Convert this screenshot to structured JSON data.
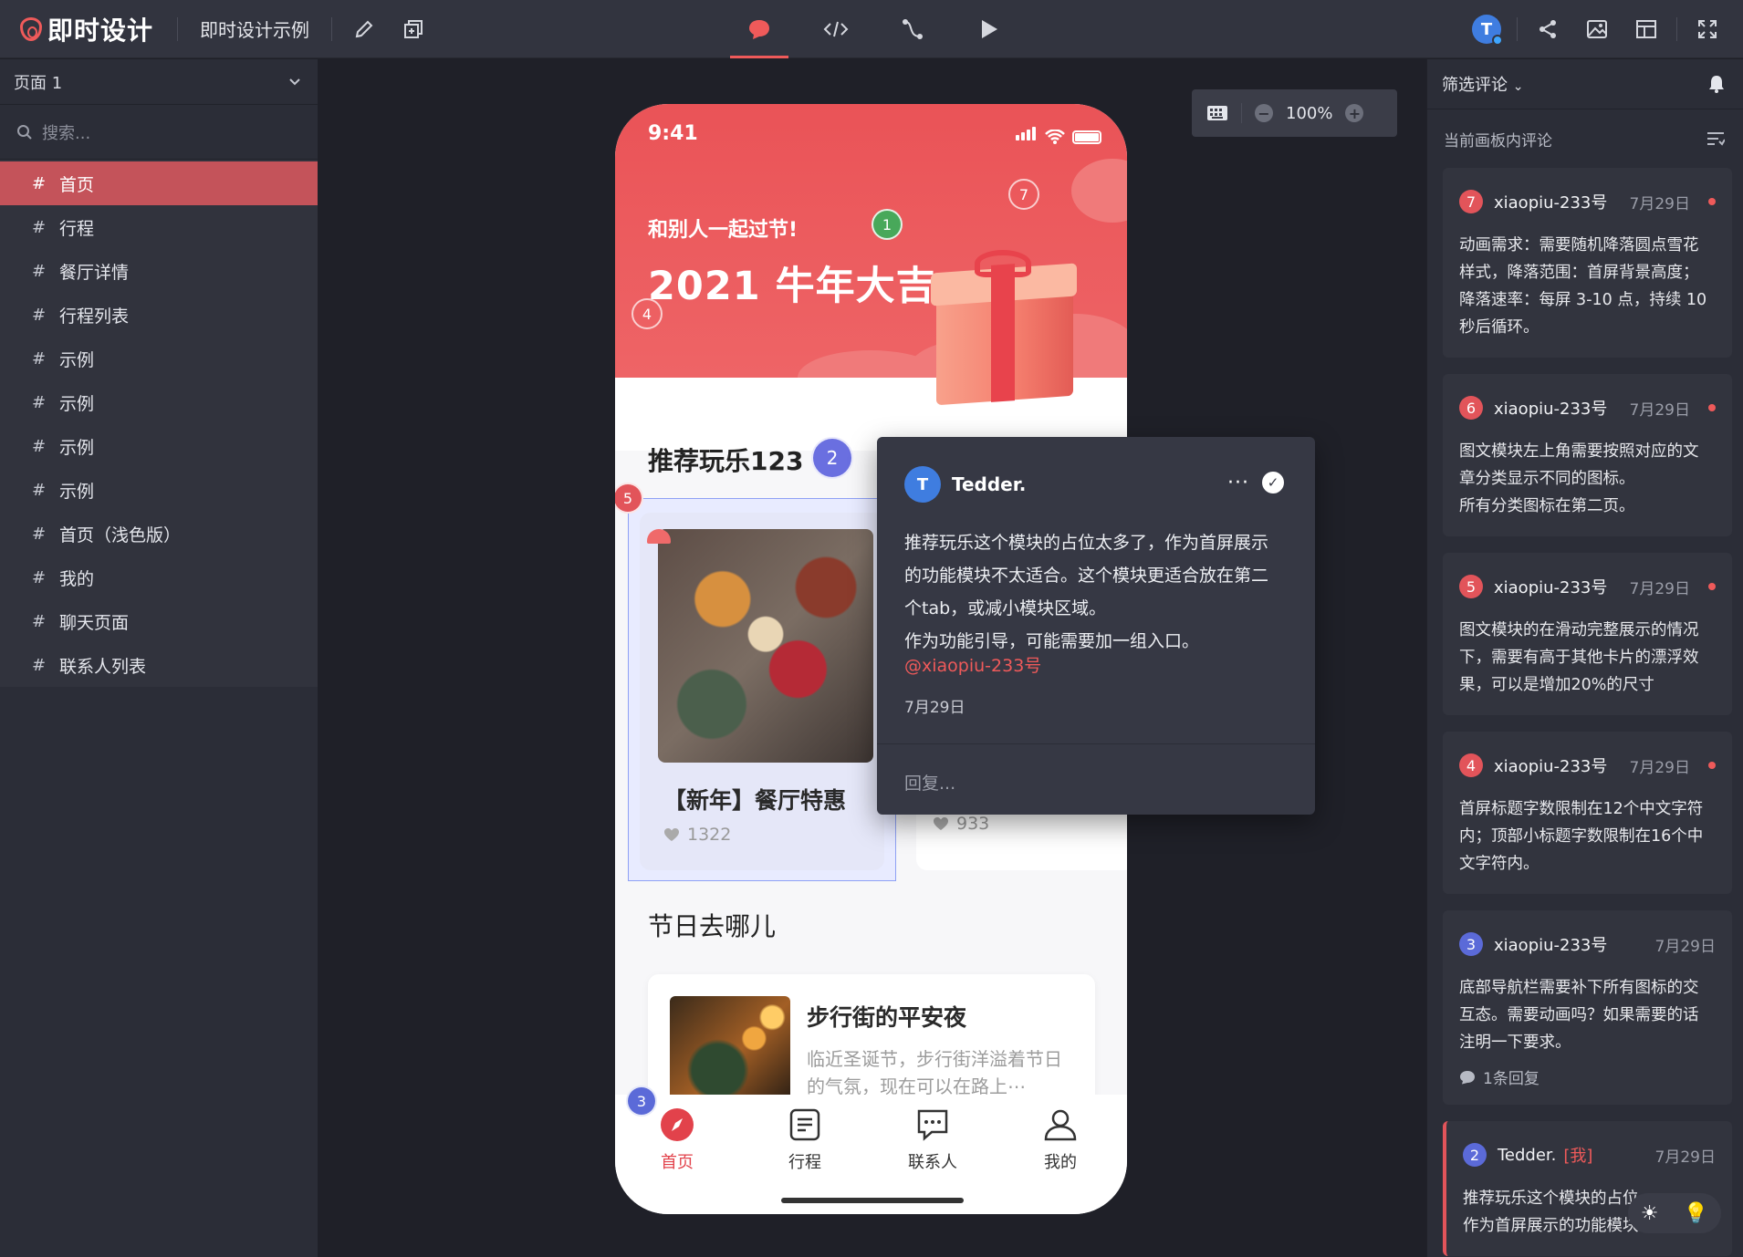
{
  "topbar": {
    "logo_text": "即时设计",
    "project_name": "即时设计示例",
    "left_icons": [
      "pencil-icon",
      "component-icon"
    ],
    "center_icons": [
      "comment-icon",
      "code-icon",
      "prototype-link-icon",
      "play-icon"
    ],
    "active_center": "comment-icon",
    "avatar_letter": "T",
    "right_icons": [
      "share-icon",
      "image-icon",
      "layout-icon",
      "fullscreen-icon"
    ]
  },
  "left_panel": {
    "page_select": "页面 1",
    "search_placeholder": "搜索...",
    "items": [
      {
        "label": "首页",
        "active": true
      },
      {
        "label": "行程"
      },
      {
        "label": "餐厅详情"
      },
      {
        "label": "行程列表"
      },
      {
        "label": "示例"
      },
      {
        "label": "示例"
      },
      {
        "label": "示例"
      },
      {
        "label": "示例"
      },
      {
        "label": "首页（浅色版）"
      },
      {
        "label": "我的"
      },
      {
        "label": "聊天页面"
      },
      {
        "label": "联系人列表"
      }
    ]
  },
  "zoom": {
    "value": "100%"
  },
  "phone": {
    "time": "9:41",
    "hero_subtitle": "和别人一起过节!",
    "hero_title": "2021 牛年大吉",
    "section1_title": "推荐玩乐123",
    "card_title": "【新年】餐厅特惠",
    "card_likes": "1322",
    "card2_likes": "933",
    "section2_title": "节日去哪儿",
    "list_title": "步行街的平安夜",
    "list_desc": "临近圣诞节，步行街洋溢着节日的气氛，现在可以在路上⋯",
    "tabs": [
      {
        "label": "首页",
        "icon": "compass-icon",
        "active": true
      },
      {
        "label": "行程",
        "icon": "document-icon"
      },
      {
        "label": "联系人",
        "icon": "chat-icon"
      },
      {
        "label": "我的",
        "icon": "user-icon"
      }
    ],
    "pins": [
      {
        "n": "1",
        "color": "#48a85a"
      },
      {
        "n": "2",
        "color": "#6a6fe0"
      },
      {
        "n": "3",
        "color": "#5b6ad8"
      },
      {
        "n": "4",
        "color": "outline"
      },
      {
        "n": "5",
        "color": "#e2545a"
      },
      {
        "n": "7",
        "color": "outline"
      }
    ]
  },
  "popover": {
    "avatar_letter": "T",
    "author": "Tedder.",
    "more": "···",
    "body": "推荐玩乐这个模块的占位太多了，作为首屏展示\n的功能模块不太适合。这个模块更适合放在第二\n个tab，或减小模块区域。\n作为功能引导，可能需要加一组入口。",
    "mention": "@xiaopiu-233号",
    "date": "7月29日",
    "reply_placeholder": "回复..."
  },
  "right_panel": {
    "filter_label": "筛选评论",
    "sub_label": "当前画板内评论",
    "comments": [
      {
        "n": "7",
        "color": "#e2545a",
        "user": "xiaopiu-233号",
        "date": "7月29日",
        "unread": true,
        "body": "动画需求：需要随机降落圆点雪花\n样式，降落范围：首屏背景高度；\n降落速率：每屏 3-10 点，持续 10\n秒后循环。"
      },
      {
        "n": "6",
        "color": "#e2545a",
        "user": "xiaopiu-233号",
        "date": "7月29日",
        "unread": true,
        "body": "图文模块左上角需要按照对应的文\n章分类显示不同的图标。\n所有分类图标在第二页。"
      },
      {
        "n": "5",
        "color": "#e2545a",
        "user": "xiaopiu-233号",
        "date": "7月29日",
        "unread": true,
        "body": "图文模块的在滑动完整展示的情况\n下，需要有高于其他卡片的漂浮效\n果，可以是增加20%的尺寸"
      },
      {
        "n": "4",
        "color": "#e2545a",
        "user": "xiaopiu-233号",
        "date": "7月29日",
        "unread": true,
        "body": "首屏标题字数限制在12个中文字符\n内；顶部小标题字数限制在16个中\n文字符内。"
      },
      {
        "n": "3",
        "color": "#5b6ad8",
        "user": "xiaopiu-233号",
        "date": "7月29日",
        "unread": false,
        "body": "底部导航栏需要补下所有图标的交\n互态。需要动画吗？如果需要的话\n注明一下要求。",
        "replies": "1条回复"
      },
      {
        "n": "2",
        "color": "#5b6ad8",
        "user": "Tedder.",
        "me": "[我]",
        "date": "7月29日",
        "unread": false,
        "mine": true,
        "body": "推荐玩乐这个模块的占位\n作为首屏展示的功能模块不太适"
      }
    ]
  }
}
